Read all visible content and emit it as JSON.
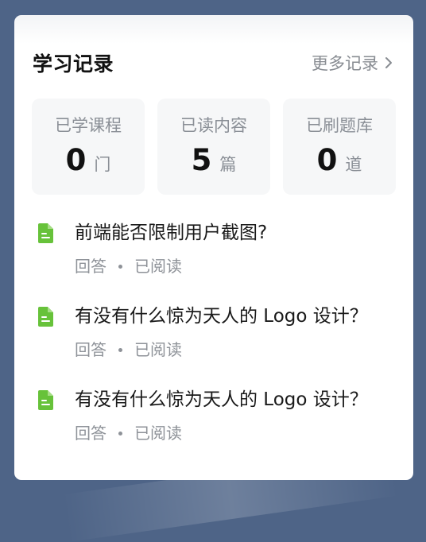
{
  "card": {
    "title": "学习记录",
    "more_label": "更多记录",
    "more_icon": "chevron-right-icon"
  },
  "stats": [
    {
      "label": "已学课程",
      "value": "0",
      "unit": "门"
    },
    {
      "label": "已读内容",
      "value": "5",
      "unit": "篇"
    },
    {
      "label": "已刷题库",
      "value": "0",
      "unit": "道"
    }
  ],
  "records": [
    {
      "title": "前端能否限制用户截图?",
      "type": "回答",
      "status": "已阅读",
      "icon": "document-icon"
    },
    {
      "title": "有没有什么惊为天人的 Logo 设计？",
      "type": "回答",
      "status": "已阅读",
      "icon": "document-icon"
    },
    {
      "title": "有没有什么惊为天人的 Logo 设计？",
      "type": "回答",
      "status": "已阅读",
      "icon": "document-icon"
    }
  ],
  "colors": {
    "background": "#4e6487",
    "doc_icon": "#67c23a",
    "muted_text": "#8a8f96"
  }
}
